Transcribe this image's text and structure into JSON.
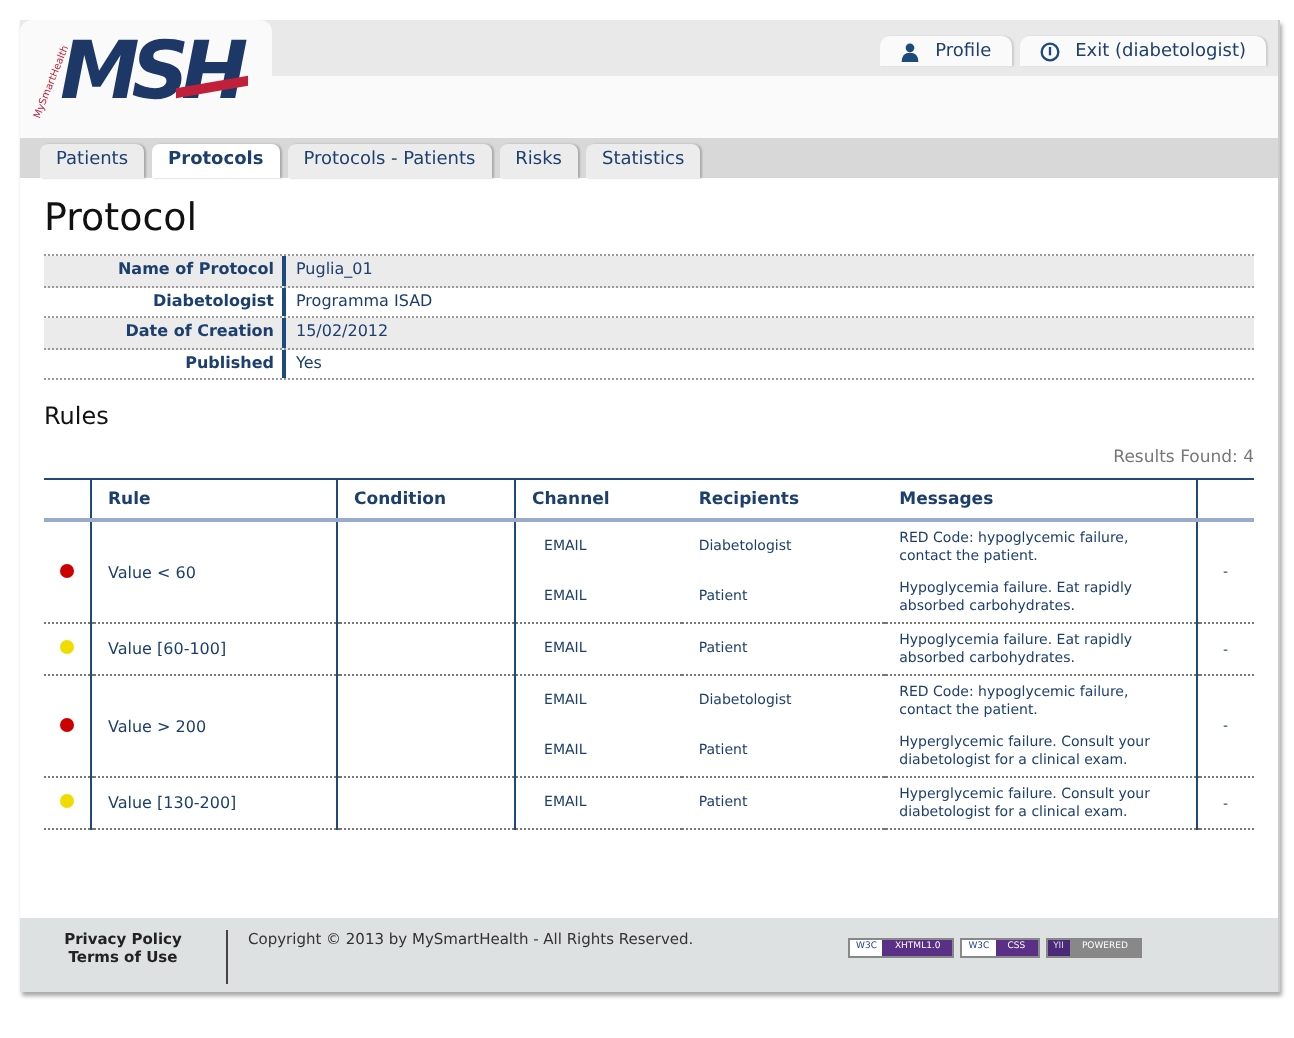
{
  "logo": {
    "letters": "MSH",
    "subtitle": "MySmartHealth"
  },
  "user_links": [
    {
      "kind": "profile",
      "label": "Profile"
    },
    {
      "kind": "exit",
      "label": "Exit (diabetologist)"
    }
  ],
  "tabs": [
    {
      "label": "Patients",
      "selected": false
    },
    {
      "label": "Protocols",
      "selected": true
    },
    {
      "label": "Protocols - Patients",
      "selected": false
    },
    {
      "label": "Risks",
      "selected": false
    },
    {
      "label": "Statistics",
      "selected": false
    }
  ],
  "page_title": "Protocol",
  "details": [
    {
      "label": "Name of Protocol",
      "value": "Puglia_01"
    },
    {
      "label": "Diabetologist",
      "value": "Programma ISAD"
    },
    {
      "label": "Date of Creation",
      "value": "15/02/2012"
    },
    {
      "label": "Published",
      "value": "Yes"
    }
  ],
  "rules_title": "Rules",
  "results_found": "Results Found: 4",
  "table": {
    "columns": [
      "Rule",
      "Condition",
      "Channel",
      "Recipients",
      "Messages"
    ],
    "rows": [
      {
        "color": "#cc0000",
        "rule": "Value < 60",
        "action": "-",
        "notifications": [
          {
            "channel": "EMAIL",
            "recipient": "Diabetologist",
            "message": "RED Code: hypoglycemic failure, contact the patient."
          },
          {
            "channel": "EMAIL",
            "recipient": "Patient",
            "message": "Hypoglycemia failure. Eat rapidly absorbed carbohydrates."
          }
        ]
      },
      {
        "color": "#f0dc00",
        "rule": "Value [60-100]",
        "action": "-",
        "notifications": [
          {
            "channel": "EMAIL",
            "recipient": "Patient",
            "message": "Hypoglycemia failure. Eat rapidly absorbed carbohydrates."
          }
        ]
      },
      {
        "color": "#cc0000",
        "rule": "Value > 200",
        "action": "-",
        "notifications": [
          {
            "channel": "EMAIL",
            "recipient": "Diabetologist",
            "message": "RED Code: hypoglycemic failure, contact the patient."
          },
          {
            "channel": "EMAIL",
            "recipient": "Patient",
            "message": "Hyperglycemic failure. Consult your diabetologist for a clinical exam."
          }
        ]
      },
      {
        "color": "#f0dc00",
        "rule": "Value [130-200]",
        "action": "-",
        "notifications": [
          {
            "channel": "EMAIL",
            "recipient": "Patient",
            "message": "Hyperglycemic failure. Consult your diabetologist for a clinical exam."
          }
        ]
      }
    ]
  },
  "footer": {
    "links": [
      "Privacy Policy",
      "Terms of Use"
    ],
    "copyright": "Copyright © 2013 by MySmartHealth - All Rights Reserved.",
    "badges": [
      {
        "left": "W3C",
        "right": "XHTML1.0"
      },
      {
        "left": "W3C",
        "right": "CSS"
      },
      {
        "left": "YII",
        "right": "POWERED"
      }
    ]
  }
}
